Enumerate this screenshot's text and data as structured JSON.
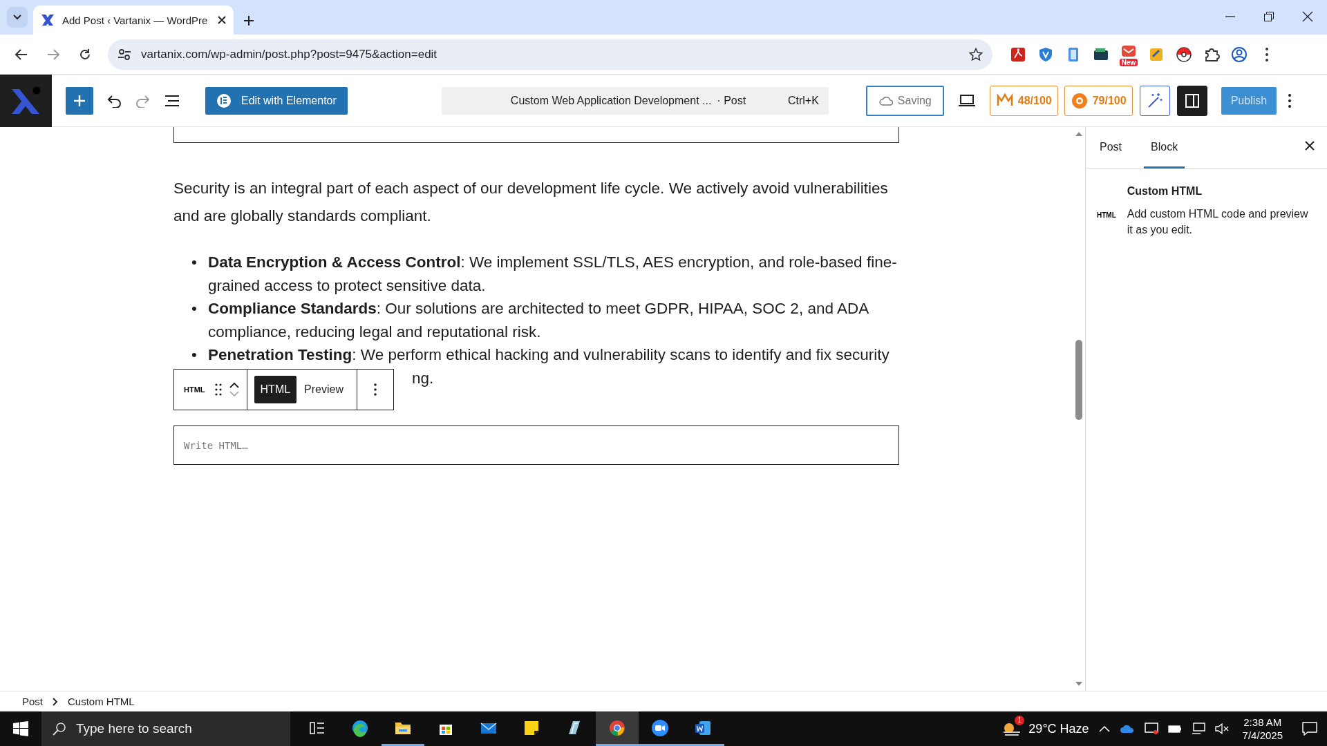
{
  "browser": {
    "tabs": [
      {
        "title": "Add Post ‹ Vartanix — WordPre",
        "selected": true
      }
    ],
    "url": "vartanix.com/wp-admin/post.php?post=9475&action=edit",
    "extension_badge": "New"
  },
  "toolbar": {
    "elementor_button": "Edit with Elementor",
    "document_title": "Custom Web Application Development ...",
    "document_type": "· Post",
    "shortcut": "Ctrl+K",
    "save_status": "Saving",
    "scores": [
      "48/100",
      "79/100"
    ],
    "publish": "Publish"
  },
  "content": {
    "paragraph": "Security is an integral part of each aspect of our development life cycle. We actively avoid vulnerabilities and are globally standards compliant.",
    "bullets": [
      {
        "marker": "•",
        "lead": "Data Encryption & Access Control",
        "text": ": We implement SSL/TLS, AES encryption, and role-based fine-grained access to protect sensitive data."
      },
      {
        "marker": "•",
        "lead": "Compliance Standards",
        "text": ": Our solutions are architected to meet GDPR, HIPAA, SOC 2, and ADA compliance, reducing legal and reputational risk."
      },
      {
        "marker": "•",
        "lead": "Penetration Testing",
        "text": ": We perform ethical hacking and vulnerability scans to identify and fix security"
      }
    ],
    "covered_tail": "ng."
  },
  "block_toolbar": {
    "block_label": "HTML",
    "tabs": [
      {
        "label": "HTML",
        "selected": true
      },
      {
        "label": "Preview",
        "selected": false
      }
    ]
  },
  "html_field": {
    "placeholder": "Write HTML…"
  },
  "sidebar": {
    "tabs": [
      {
        "label": "Post",
        "selected": false
      },
      {
        "label": "Block",
        "selected": true
      }
    ],
    "block_icon": "HTML",
    "block_title": "Custom HTML",
    "block_description": "Add custom HTML code and preview it as you edit."
  },
  "breadcrumb": [
    "Post",
    "Custom HTML"
  ],
  "taskbar": {
    "search_placeholder": "Type here to search",
    "apps": [
      {
        "kind": "taskview",
        "running": false,
        "selected": false
      },
      {
        "kind": "edge",
        "running": false,
        "selected": false
      },
      {
        "kind": "folder",
        "running": true,
        "selected": false
      },
      {
        "kind": "store",
        "running": false,
        "selected": false
      },
      {
        "kind": "mail",
        "running": false,
        "selected": false
      },
      {
        "kind": "notes",
        "running": false,
        "selected": false
      },
      {
        "kind": "glass",
        "running": false,
        "selected": false
      },
      {
        "kind": "chrome",
        "running": true,
        "selected": true
      },
      {
        "kind": "zoom",
        "running": true,
        "selected": false
      },
      {
        "kind": "word",
        "running": true,
        "selected": false
      }
    ],
    "weather_badge": "1",
    "weather": "29°C Haze",
    "time": "2:38 AM",
    "date": "7/4/2025"
  }
}
